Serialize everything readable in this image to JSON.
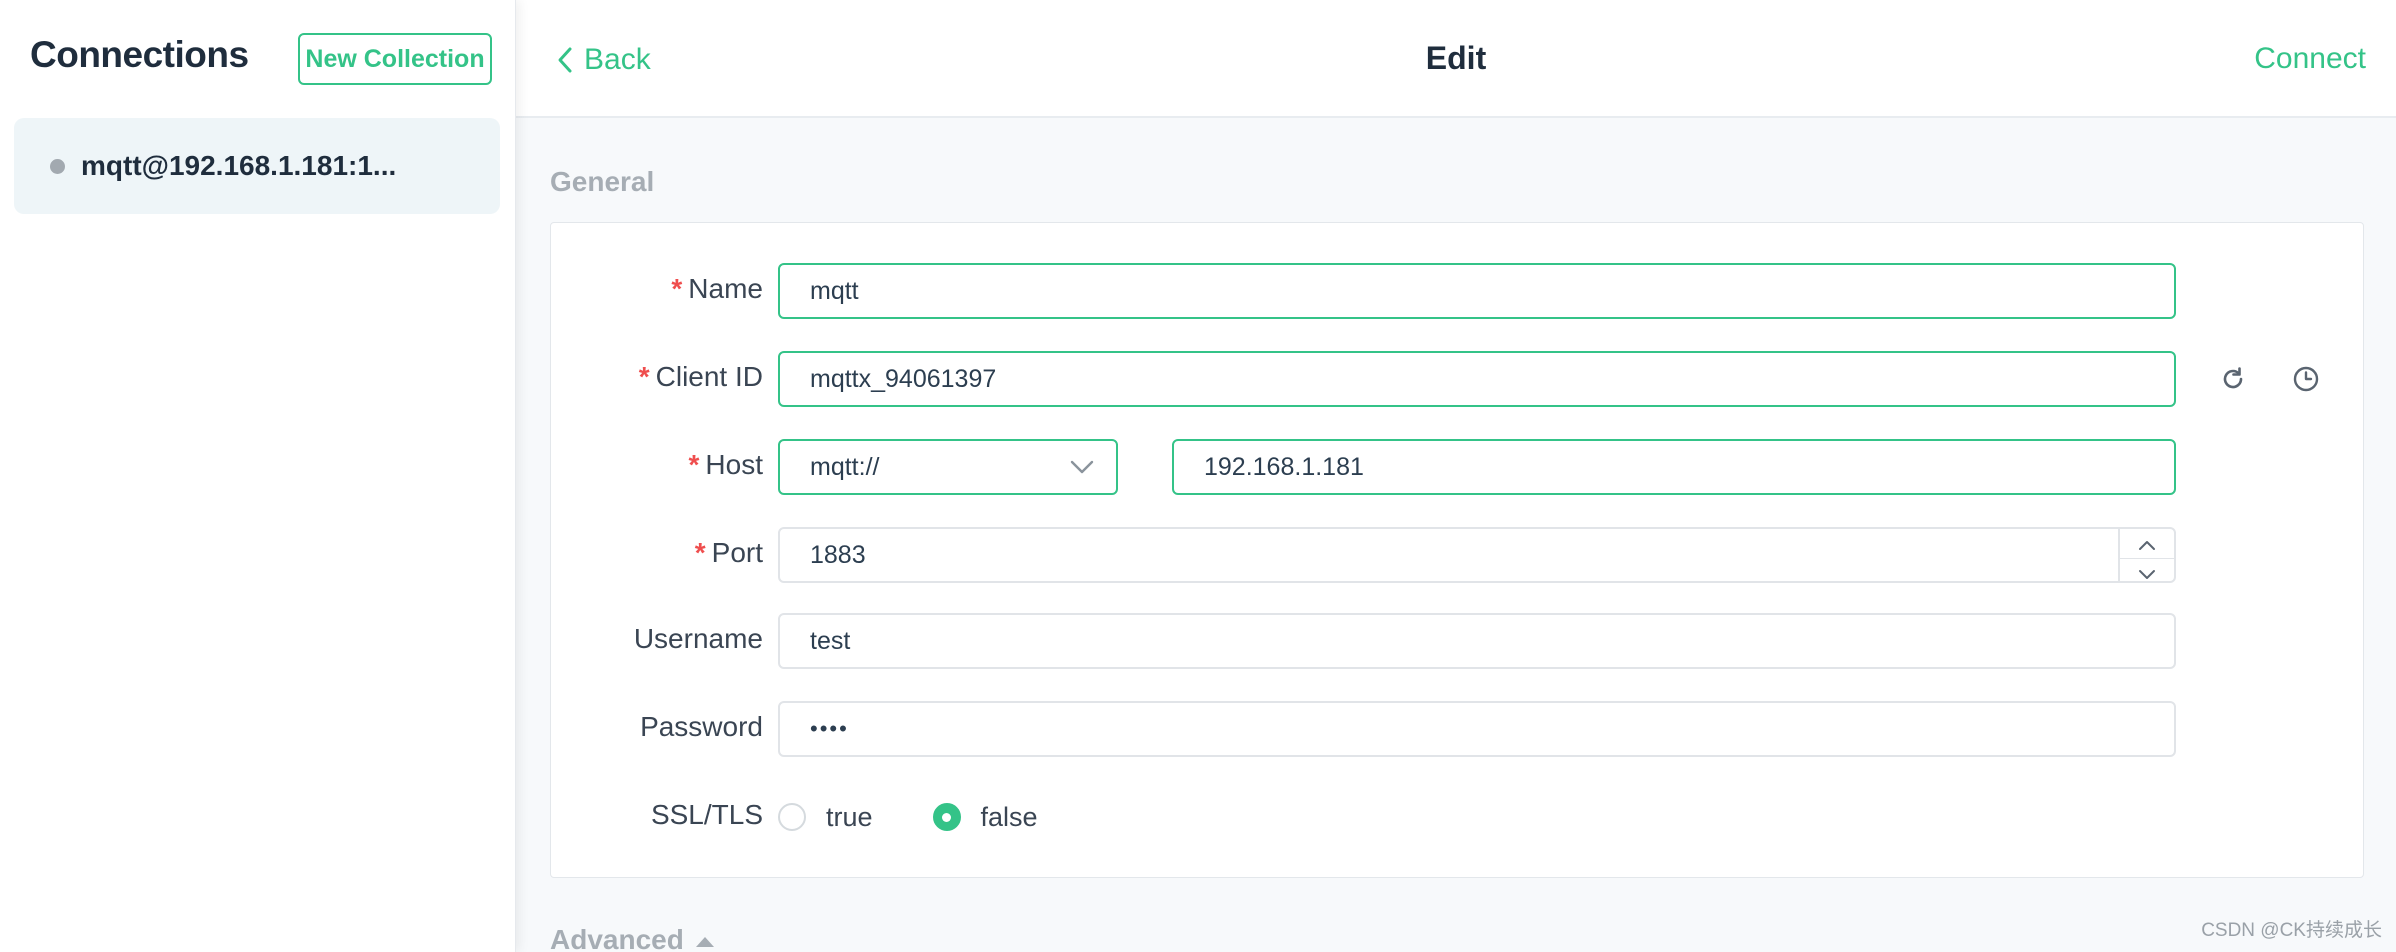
{
  "sidebar": {
    "title": "Connections",
    "new_collection_label": "New Collection",
    "connections": [
      {
        "label": "mqtt@192.168.1.181:1...",
        "status_color": "#a2a9b0"
      }
    ]
  },
  "header": {
    "back_label": "Back",
    "title": "Edit",
    "connect_label": "Connect"
  },
  "general": {
    "section_title": "General",
    "name": {
      "label": "Name",
      "value": "mqtt",
      "required": true
    },
    "client_id": {
      "label": "Client ID",
      "value": "mqttx_94061397",
      "required": true,
      "icons": [
        "refresh-icon",
        "clock-icon"
      ]
    },
    "host": {
      "label": "Host",
      "protocol": "mqtt://",
      "value": "192.168.1.181",
      "required": true
    },
    "port": {
      "label": "Port",
      "value": "1883",
      "required": true
    },
    "username": {
      "label": "Username",
      "value": "test"
    },
    "password": {
      "label": "Password",
      "value": "••••"
    },
    "ssl_tls": {
      "label": "SSL/TLS",
      "options": [
        {
          "label": "true",
          "selected": false
        },
        {
          "label": "false",
          "selected": true
        }
      ]
    }
  },
  "advanced": {
    "section_title": "Advanced"
  },
  "watermark": "CSDN @CK持续成长",
  "colors": {
    "accent": "#34c388",
    "required": "#ef4e4e",
    "muted": "#a6adb4"
  }
}
